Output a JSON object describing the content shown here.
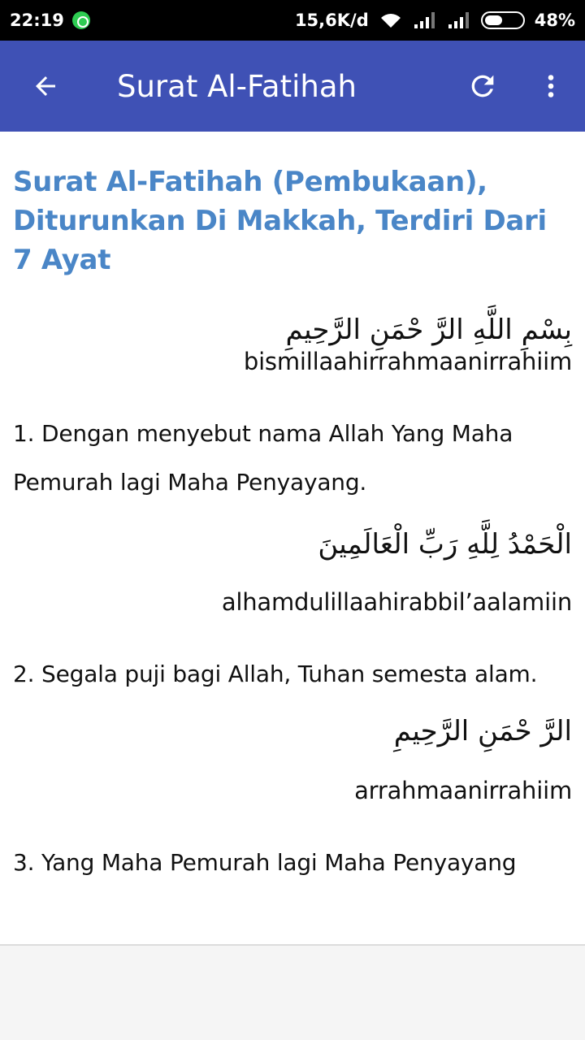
{
  "status_bar": {
    "time": "22:19",
    "network_speed": "15,6K/d",
    "battery_percent": "48%",
    "battery_level": 0.48,
    "icons": [
      "whatsapp-icon",
      "wifi-icon",
      "signal-icon",
      "signal-icon",
      "battery-icon"
    ]
  },
  "app_bar": {
    "title": "Surat Al-Fatihah",
    "back_icon": "arrow-back-icon",
    "refresh_icon": "refresh-icon",
    "menu_icon": "more-vert-icon",
    "color": "#3f51b5"
  },
  "content": {
    "heading": "Surat Al-Fatihah (Pembukaan), Diturunkan Di Makkah, Terdiri Dari 7 Ayat",
    "heading_color": "#4a86c7",
    "verses": [
      {
        "arabic": "بِسْمِ اللَّهِ الرَّ حْمَنِ الرَّحِيمِ",
        "latin": "bismillaahirrahmaanirrahiim",
        "meaning": "1. Dengan menyebut nama Allah Yang Maha Pemurah lagi Maha Penyayang."
      },
      {
        "arabic": "الْحَمْدُ لِلَّهِ رَبِّ الْعَالَمِينَ",
        "latin": "alhamdulillaahirabbil’aalamiin",
        "meaning": "2. Segala puji bagi Allah, Tuhan semesta alam."
      },
      {
        "arabic": "الرَّ حْمَنِ الرَّحِيمِ",
        "latin": "arrahmaanirrahiim",
        "meaning": "3. Yang Maha Pemurah lagi Maha Penyayang"
      }
    ]
  }
}
